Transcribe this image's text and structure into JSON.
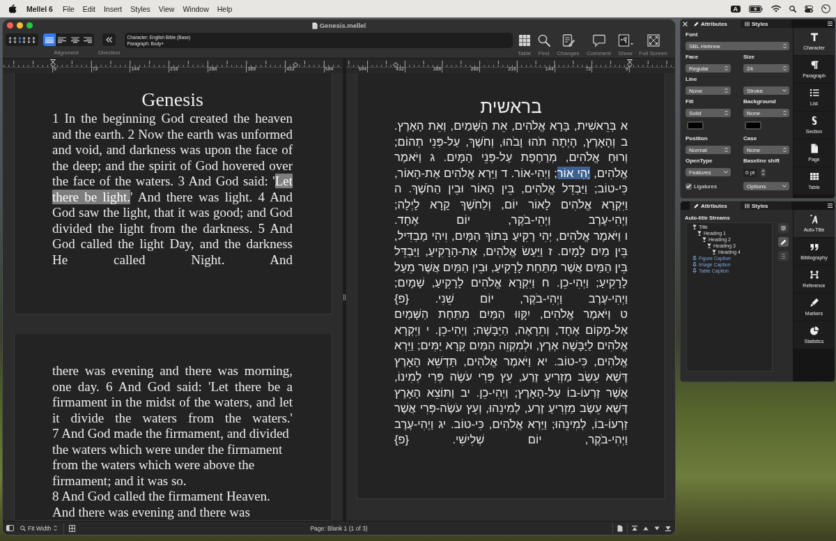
{
  "menubar": {
    "app_name": "Mellel 6",
    "menus": [
      "File",
      "Edit",
      "Insert",
      "Styles",
      "View",
      "Window",
      "Help"
    ],
    "input_source": "A"
  },
  "window": {
    "title": "Genesis.mellel"
  },
  "toolbar": {
    "line_spacing": [
      {
        "selected": false
      },
      {
        "selected": false
      },
      {
        "selected": true
      },
      {
        "selected": false
      },
      {
        "selected": false
      },
      {
        "selected": false
      }
    ],
    "alignment": {
      "label": "Alignment",
      "options": [
        {
          "kind": "justify",
          "selected": true
        },
        {
          "kind": "left",
          "selected": false
        },
        {
          "kind": "center",
          "selected": false
        },
        {
          "kind": "right",
          "selected": false
        }
      ]
    },
    "direction": {
      "label": "Direction"
    },
    "style_info": {
      "character": "Character: English Bible (Base)",
      "paragraph": "Paragraph: Body+"
    },
    "buttons": [
      {
        "kind": "table",
        "label": "Table"
      },
      {
        "kind": "find",
        "label": "Find"
      },
      {
        "kind": "changes",
        "label": "Changes"
      },
      {
        "kind": "comment",
        "label": "Comment"
      },
      {
        "kind": "show",
        "label": "Show"
      },
      {
        "kind": "full_screen",
        "label": "Full Screen"
      }
    ]
  },
  "rulers": [
    {
      "kind": "ltr",
      "labels": [
        "0",
        "72",
        "144",
        "216",
        "288",
        "360",
        "432",
        "504"
      ]
    },
    {
      "kind": "rtl",
      "labels": [
        "504",
        "432",
        "360",
        "288",
        "216",
        "144",
        "72",
        "0"
      ]
    }
  ],
  "documents": [
    {
      "kind": "ltr",
      "focused": false,
      "pages": [
        {
          "title": "Genesis",
          "paragraphs": [
            {
              "kind": "justified",
              "runs": [
                {
                  "text": "1 In the beginning God created the heaven and the earth. 2 Now the earth was unformed and void, and darkness was upon the face of the deep; and the spirit of God hovered over the face of the waters. 3 And God said: '",
                  "selected": false
                },
                {
                  "text": "Let there be light.",
                  "selected": true
                },
                {
                  "text": "' And there was light. 4 And God saw the light, that it was good; and God divided the light from the darkness. 5 And God called the light Day, and the darkness He called Night. And",
                  "selected": false
                }
              ]
            }
          ]
        },
        {
          "paragraphs": [
            {
              "kind": "justified",
              "runs": [
                {
                  "text": "there was evening and there was morning, one day. 6 And God said: 'Let there be a firmament in the midst of the waters, and let it divide the waters from the waters.'",
                  "selected": false
                }
              ]
            },
            {
              "kind": "ragged",
              "runs": [
                {
                  "text": "7 And God made the firmament, and divided the waters which were under the firmament from the waters which were above the firmament; and it was so.",
                  "selected": false
                }
              ]
            },
            {
              "kind": "ragged",
              "runs": [
                {
                  "text": "8 And God called the firmament Heaven. And there was evening and there was",
                  "selected": false
                }
              ]
            }
          ]
        }
      ]
    },
    {
      "kind": "rtl",
      "focused": true,
      "pages": [
        {
          "title": "בראשית",
          "paragraphs": [
            {
              "kind": "justified",
              "runs": [
                {
                  "text": "א בְּרֵאשִׁית, בָּרָא אֱלֹהִים, אֵת הַשָּׁמַיִם, וְאֵת הָאָרֶץ. ב וְהָאָרֶץ, הָיְתָה תֹהוּ וָבֹהוּ, וְחֹשֶׁךְ, עַל-פְּנֵי תְהוֹם; וְרוּחַ אֱלֹהִים, מְרַחֶפֶת עַל-פְּנֵי הַמָּיִם. ג וַיֹּאמֶר אֱלֹהִים, ",
                  "selected": false
                },
                {
                  "text": "יְהִי אוֹר",
                  "selected": true
                },
                {
                  "text": "; וַיְהִי-אוֹר. ד וַיַּרְא אֱלֹהִים אֶת-הָאוֹר, כִּי-טוֹב; וַיַּבְדֵּל אֱלֹהִים, בֵּין הָאוֹר וּבֵין הַחֹשֶׁךְ. ה וַיִּקְרָא אֱלֹהִים לָאוֹר יוֹם, וְלַחֹשֶׁךְ קָרָא לָיְלָה; וַיְהִי-עֶרֶב וַיְהִי-בֹקֶר, יוֹם אֶחָד.",
                  "selected": false
                }
              ]
            },
            {
              "kind": "justified",
              "runs": [
                {
                  "text": "ו וַיֹּאמֶר אֱלֹהִים, יְהִי רָקִיעַ בְּתוֹךְ הַמָּיִם, וִיהִי מַבְדִּיל, בֵּין מַיִם לָמָיִם. ז וַיַּעַשׂ אֱלֹהִים, אֶת-הָרָקִיעַ, וַיַּבְדֵּל בֵּין הַמַּיִם אֲשֶׁר מִתַּחַת לָרָקִיעַ, וּבֵין הַמַּיִם אֲשֶׁר מֵעַל לָרָקִיעַ; וַיְהִי-כֵן. ח וַיִּקְרָא אֱלֹהִים לָרָקִיעַ, שָׁמָיִם; וַיְהִי-עֶרֶב וַיְהִי-בֹקֶר, יוֹם שֵׁנִי. {פ}",
                  "selected": false
                }
              ]
            },
            {
              "kind": "justified",
              "runs": [
                {
                  "text": "ט וַיֹּאמֶר אֱלֹהִים, יִקָּווּ הַמַּיִם מִתַּחַת הַשָּׁמַיִם אֶל-מָקוֹם אֶחָד, וְתֵרָאֶה, הַיַּבָּשָׁה; וַיְהִי-כֵן. י וַיִּקְרָא אֱלֹהִים לַיַּבָּשָׁה אֶרֶץ, וּלְמִקְוֵה הַמַּיִם קָרָא יַמִּים; וַיַּרְא אֱלֹהִים, כִּי-טוֹב. יא וַיֹּאמֶר אֱלֹהִים, תַּדְשֵׁא הָאָרֶץ דֶּשֶׁא עֵשֶׂב מַזְרִיעַ זֶרַע, עֵץ פְּרִי עֹשֶׂה פְּרִי לְמִינוֹ, אֲשֶׁר זַרְעוֹ-בוֹ עַל-הָאָרֶץ; וַיְהִי-כֵן. יב וַתּוֹצֵא הָאָרֶץ דֶּשֶׁא עֵשֶׂב מַזְרִיעַ זֶרַע, לְמִינֵהוּ, וְעֵץ עֹשֶׂה-פְּרִי אֲשֶׁר זַרְעוֹ-בוֹ, לְמִינֵהוּ; וַיַּרְא אֱלֹהִים, כִּי-טוֹב. יג וַיְהִי-עֶרֶב וַיְהִי-בֹקֶר, יוֹם שְׁלִישִׁי. {פ}",
                  "selected": false
                }
              ]
            }
          ]
        }
      ]
    }
  ],
  "status_bar": {
    "zoom": "Fit Width",
    "page_info": "Page: Blank 1 (1 of 3)"
  },
  "character_palette": {
    "closable": true,
    "tabs": [
      {
        "kind": "attributes",
        "label": "Attributes",
        "selected": true
      },
      {
        "kind": "styles",
        "label": "Styles",
        "selected": false
      }
    ],
    "font": {
      "label": "Font",
      "value": "SBL Hebrew"
    },
    "face": {
      "label": "Face",
      "value": "Regular"
    },
    "size": {
      "label": "Size",
      "value": "24"
    },
    "line": {
      "label": "Line",
      "value": "None"
    },
    "stroke": {
      "value": "Stroke"
    },
    "fill": {
      "label": "Fill",
      "value": "Solid",
      "color": "#000000"
    },
    "background": {
      "label": "Background",
      "value": "None",
      "color": "#000000"
    },
    "position": {
      "label": "Position",
      "value": "Normal"
    },
    "case": {
      "label": "Case",
      "value": "None"
    },
    "opentype": {
      "label": "OpenType",
      "value": "Features"
    },
    "baseline_shift": {
      "label": "Baseline shift",
      "value": "0 pt"
    },
    "ligatures": {
      "label": "Ligatures",
      "checked": true
    },
    "options": {
      "value": "Options"
    },
    "side_tabs": [
      {
        "kind": "character",
        "label": "Character",
        "selected": true
      },
      {
        "kind": "paragraph",
        "label": "Paragraph",
        "selected": false
      },
      {
        "kind": "list",
        "label": "List",
        "selected": false
      },
      {
        "kind": "section",
        "label": "Section",
        "selected": false
      },
      {
        "kind": "page",
        "label": "Page",
        "selected": false
      },
      {
        "kind": "table",
        "label": "Table",
        "selected": false
      }
    ]
  },
  "auto_title_palette": {
    "tabs": [
      {
        "kind": "attributes",
        "label": "Attributes",
        "selected": true
      },
      {
        "kind": "styles",
        "label": "Styles",
        "selected": false
      }
    ],
    "heading": "Auto-title Streams",
    "streams": [
      {
        "kind": "heading",
        "label": "Title",
        "children": [
          {
            "kind": "heading",
            "label": "Heading 1",
            "children": [
              {
                "kind": "heading",
                "label": "Heading 2",
                "children": [
                  {
                    "kind": "heading",
                    "label": "Heading 3",
                    "children": [
                      {
                        "kind": "heading",
                        "label": "Heading 4"
                      }
                    ]
                  }
                ]
              }
            ]
          }
        ]
      },
      {
        "kind": "caption",
        "label": "Figure Caption"
      },
      {
        "kind": "caption",
        "label": "Image Caption"
      },
      {
        "kind": "caption",
        "label": "Table Caption"
      }
    ],
    "tools": [
      {
        "kind": "tag",
        "disabled": true
      },
      {
        "kind": "edit",
        "disabled": false
      },
      {
        "kind": "list",
        "disabled": true
      }
    ],
    "side_tabs": [
      {
        "kind": "auto_title",
        "label": "Auto-Title",
        "selected": true
      },
      {
        "kind": "bibliography",
        "label": "Bibliography",
        "selected": false
      },
      {
        "kind": "reference",
        "label": "Reference",
        "selected": false
      },
      {
        "kind": "markers",
        "label": "Markers",
        "selected": false
      },
      {
        "kind": "statistics",
        "label": "Statistics",
        "selected": false
      }
    ]
  }
}
